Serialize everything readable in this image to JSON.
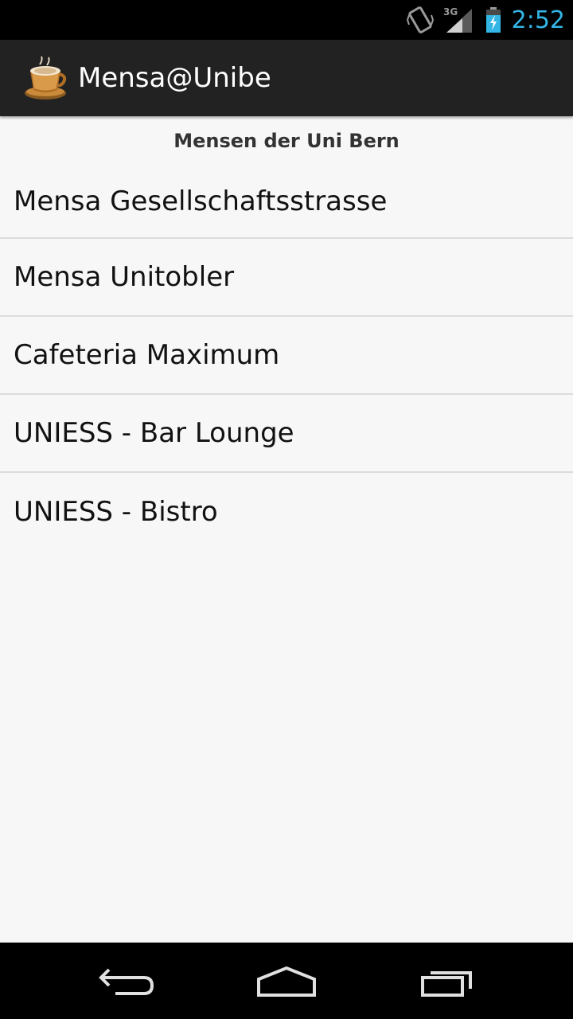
{
  "status_bar": {
    "time": "2:52",
    "network_label": "3G",
    "icons": [
      "vibrate-icon",
      "signal-icon",
      "battery-charging-icon"
    ],
    "time_color": "#33b5e5"
  },
  "action_bar": {
    "title": "Mensa@Unibe",
    "icon": "coffee-cup-icon",
    "background": "#222222"
  },
  "list": {
    "header": "Mensen der Uni Bern",
    "items": [
      {
        "label": "Mensa Gesellschaftsstrasse"
      },
      {
        "label": "Mensa Unitobler"
      },
      {
        "label": "Cafeteria Maximum"
      },
      {
        "label": "UNIESS - Bar Lounge"
      },
      {
        "label": "UNIESS - Bistro"
      }
    ]
  },
  "nav_bar": {
    "buttons": [
      "back-icon",
      "home-icon",
      "recent-apps-icon"
    ]
  }
}
